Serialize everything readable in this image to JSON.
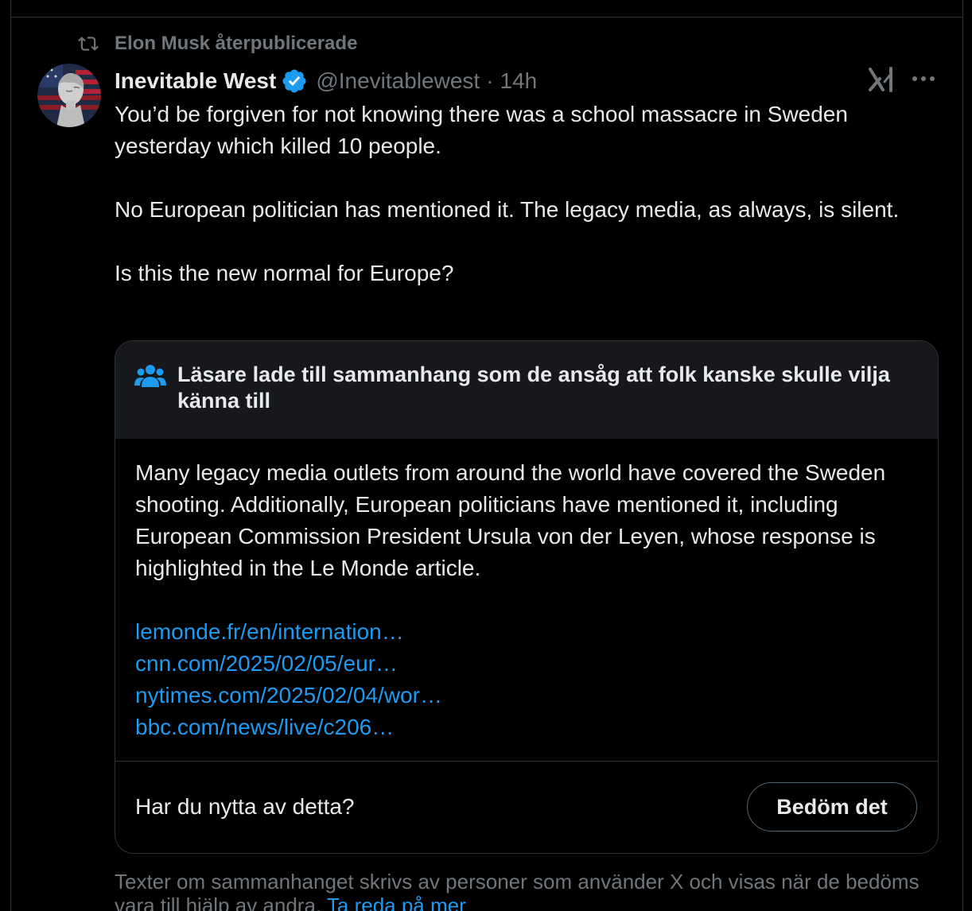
{
  "repost": {
    "label": "Elon Musk återpublicerade",
    "icon": "repost-icon"
  },
  "author": {
    "display_name": "Inevitable West",
    "handle": "@Inevitablewest",
    "separator": "·",
    "time": "14h",
    "verified": true,
    "verified_color": "#1d9bf0"
  },
  "tweet": {
    "paragraphs": [
      "You’d be forgiven for not knowing there was a school massacre in Sweden yesterday which killed 10 people.",
      "No European politician has mentioned it. The legacy media, as always, is silent.",
      "Is this the new normal for Europe?"
    ]
  },
  "community_note": {
    "title": "Läsare lade till sammanhang som de ansåg att folk kanske skulle vilja känna till",
    "body": "Many legacy media outlets from around the world have covered the Sweden shooting. Additionally, European politicians have mentioned it, including European Commission President Ursula von der Leyen, whose response is highlighted in the Le Monde article.",
    "links": [
      "lemonde.fr/en/internation…",
      "cnn.com/2025/02/05/eur…",
      "nytimes.com/2025/02/04/wor…",
      "bbc.com/news/live/c206…"
    ],
    "question": "Har du nytta av detta?",
    "rate_button": "Bedöm det"
  },
  "footer": {
    "text": "Texter om sammanhanget skrivs av personer som använder X och visas när de bedöms vara till hjälp av andra.",
    "link": "Ta reda på mer"
  },
  "colors": {
    "background": "#000000",
    "text": "#e7e9ea",
    "muted": "#71767b",
    "link": "#1d9bf0",
    "border": "#2f3336",
    "note_header_bg": "#16181c"
  }
}
